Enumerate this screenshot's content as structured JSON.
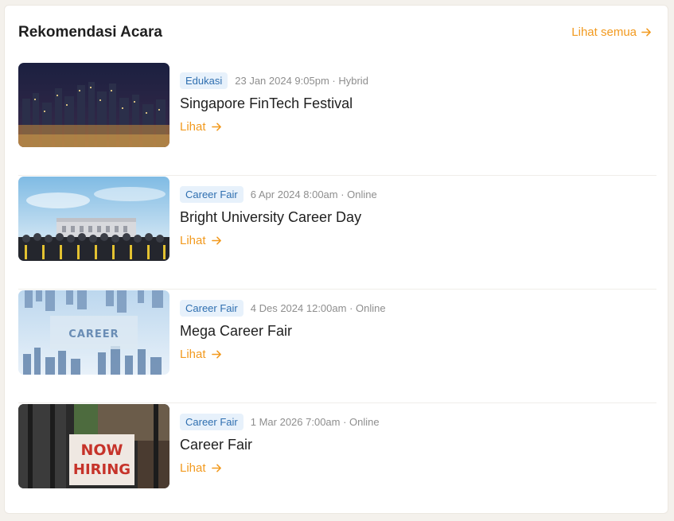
{
  "header": {
    "title": "Rekomendasi Acara",
    "see_all_label": "Lihat semua"
  },
  "colors": {
    "accent": "#f29a1f",
    "badge_bg": "#e7f1fb",
    "badge_text": "#2f6fb0"
  },
  "events": [
    {
      "category": "Edukasi",
      "datetime": "23 Jan 2024 9:05pm",
      "mode": "Hybrid",
      "title": "Singapore FinTech Festival",
      "link_label": "Lihat",
      "image": "city-skyline-night"
    },
    {
      "category": "Career Fair",
      "datetime": "6 Apr 2024 8:00am",
      "mode": "Online",
      "title": "Bright University Career Day",
      "link_label": "Lihat",
      "image": "graduation-building"
    },
    {
      "category": "Career Fair",
      "datetime": "4 Des 2024 12:00am",
      "mode": "Online",
      "title": "Mega Career Fair",
      "link_label": "Lihat",
      "image": "career-skyline",
      "image_text": "CAREER"
    },
    {
      "category": "Career Fair",
      "datetime": "1 Mar 2026 7:00am",
      "mode": "Online",
      "title": "Career Fair",
      "link_label": "Lihat",
      "image": "now-hiring-sign",
      "image_text": [
        "NOW",
        "HIRING"
      ]
    }
  ]
}
